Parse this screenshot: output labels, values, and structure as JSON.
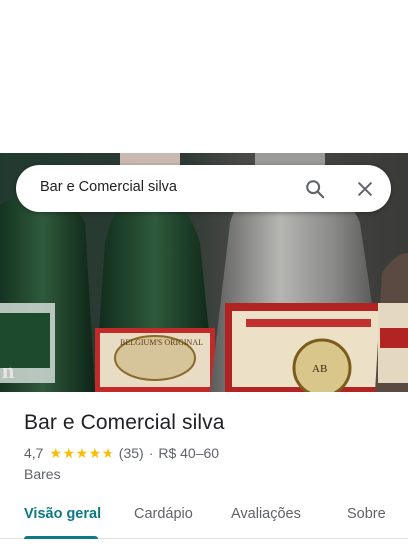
{
  "search": {
    "query": "Bar e Comercial silva"
  },
  "place": {
    "name": "Bar e Comercial silva",
    "rating": "4,7",
    "rating_value": 4.7,
    "reviews": "(35)",
    "separator": "·",
    "price_range": "R$ 40–60",
    "category": "Bares"
  },
  "tabs": [
    {
      "label": "Visão geral",
      "active": true
    },
    {
      "label": "Cardápio",
      "active": false
    },
    {
      "label": "Avaliações",
      "active": false
    },
    {
      "label": "Sobre",
      "active": false
    }
  ],
  "colors": {
    "accent": "#0b7a83",
    "star": "#fbbc04"
  },
  "icons": {
    "search": "search-icon",
    "close": "close-icon",
    "star": "star-icon"
  }
}
